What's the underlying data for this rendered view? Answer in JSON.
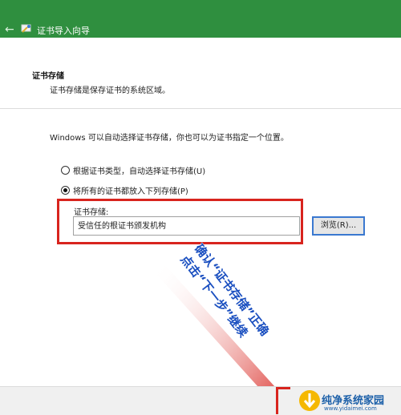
{
  "wizard": {
    "title": "证书导入向导",
    "back_glyph": "←"
  },
  "header": {
    "title": "证书存储",
    "description": "证书存储是保存证书的系统区域。"
  },
  "body": {
    "intro": "Windows 可以自动选择证书存储，你也可以为证书指定一个位置。",
    "radio_auto": "根据证书类型，自动选择证书存储(U)",
    "radio_manual": "将所有的证书都放入下列存储(P)",
    "radio_selected": "manual",
    "store_label": "证书存储:",
    "store_value": "受信任的根证书颁发机构",
    "browse_label": "浏览(R)..."
  },
  "annotation": {
    "line1": "确认“证书存储”正确",
    "line2": "点击“下一步”继续",
    "color": "#1a4fc0"
  },
  "accent_colors": {
    "title_bar": "#2f8f3f",
    "highlight": "#d8241e"
  },
  "watermark": {
    "title": "纯净系统家园",
    "url": "www.yidaimei.com"
  }
}
